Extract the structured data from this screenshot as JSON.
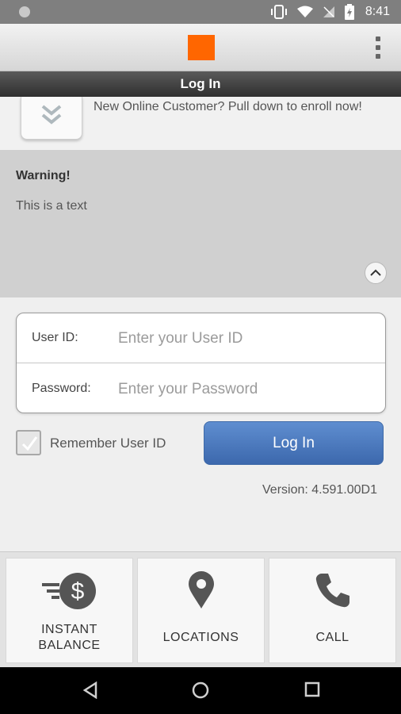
{
  "status_bar": {
    "time": "8:41",
    "icons": [
      "notification-dot-icon",
      "vibrate-icon",
      "wifi-icon",
      "no-sim-icon",
      "battery-icon"
    ]
  },
  "header": {
    "logo": "orange-square-logo",
    "brand_color": "#ff6600",
    "menu_icon": "overflow-menu-icon"
  },
  "title_bar": {
    "title": "Log In"
  },
  "enroll": {
    "text": "New Online Customer? Pull down to enroll now!"
  },
  "warning": {
    "title": "Warning!",
    "body": "This is a text"
  },
  "login_form": {
    "user_id_label": "User ID:",
    "user_id_placeholder": "Enter your User ID",
    "user_id_value": "",
    "password_label": "Password:",
    "password_placeholder": "Enter your Password",
    "password_value": "",
    "remember_label": "Remember User ID",
    "remember_checked": true,
    "login_button": "Log In",
    "button_color": "#4a78bd"
  },
  "version": {
    "text": "Version: 4.591.00D1"
  },
  "quick_actions": [
    {
      "line1": "INSTANT",
      "line2": "BALANCE",
      "icon": "instant-balance-icon"
    },
    {
      "line1": "LOCATIONS",
      "line2": "",
      "icon": "location-pin-icon"
    },
    {
      "line1": "CALL",
      "line2": "",
      "icon": "phone-icon"
    }
  ],
  "nav_bar": {
    "icons": [
      "back-icon",
      "home-icon",
      "recents-icon"
    ]
  }
}
